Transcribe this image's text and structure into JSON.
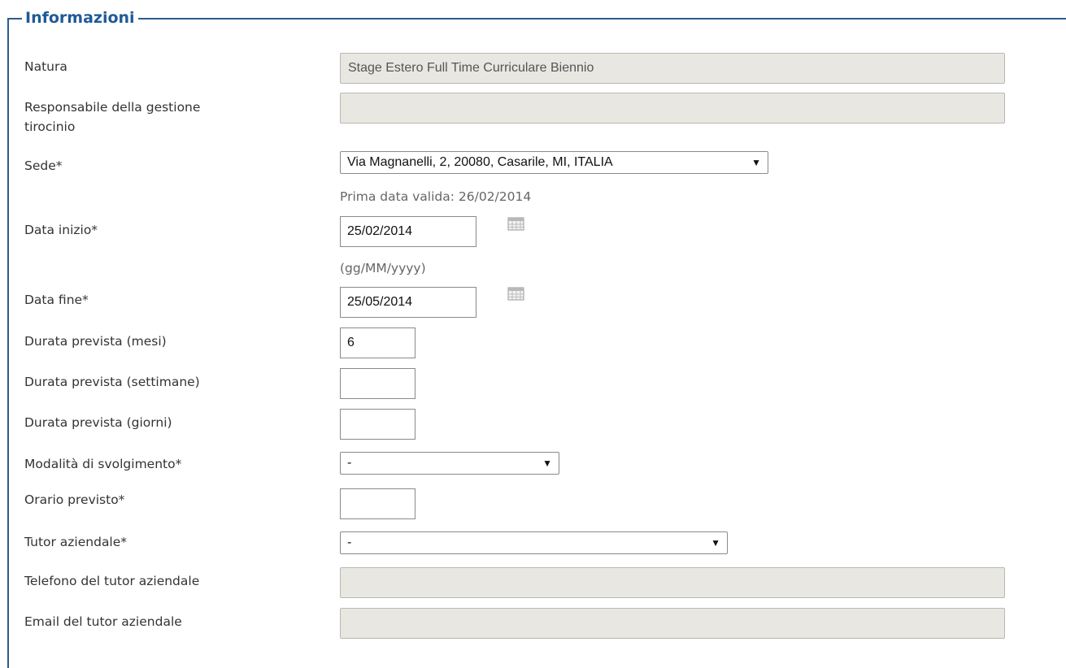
{
  "section": {
    "title": "Informazioni"
  },
  "fields": {
    "natura": {
      "label": "Natura",
      "value": "Stage Estero Full Time Curriculare Biennio"
    },
    "responsabile": {
      "label_line1": "Responsabile della gestione",
      "label_line2": "tirocinio",
      "value": ""
    },
    "sede": {
      "label": "Sede*",
      "value": "Via Magnanelli, 2, 20080, Casarile, MI, ITALIA",
      "hint": "Prima data valida: 26/02/2014"
    },
    "data_inizio": {
      "label": "Data inizio*",
      "value": "25/02/2014",
      "format_hint": "(gg/MM/yyyy)"
    },
    "data_fine": {
      "label": "Data fine*",
      "value": "25/05/2014"
    },
    "durata_mesi": {
      "label": "Durata prevista (mesi)",
      "value": "6"
    },
    "durata_settimane": {
      "label": "Durata prevista (settimane)",
      "value": ""
    },
    "durata_giorni": {
      "label": "Durata prevista (giorni)",
      "value": ""
    },
    "modalita": {
      "label": "Modalità di svolgimento*",
      "value": "-"
    },
    "orario": {
      "label": "Orario previsto*",
      "value": ""
    },
    "tutor": {
      "label": "Tutor aziendale*",
      "value": "-"
    },
    "telefono_tutor": {
      "label": "Telefono del tutor aziendale",
      "value": ""
    },
    "email_tutor": {
      "label": "Email del tutor aziendale",
      "value": ""
    }
  },
  "icons": {
    "calendar": "calendar-icon",
    "dropdown": "dropdown-arrow-icon"
  },
  "colors": {
    "legend": "#1f5a96",
    "border": "#2b5c8a",
    "readonly_bg": "#e8e7e2"
  }
}
